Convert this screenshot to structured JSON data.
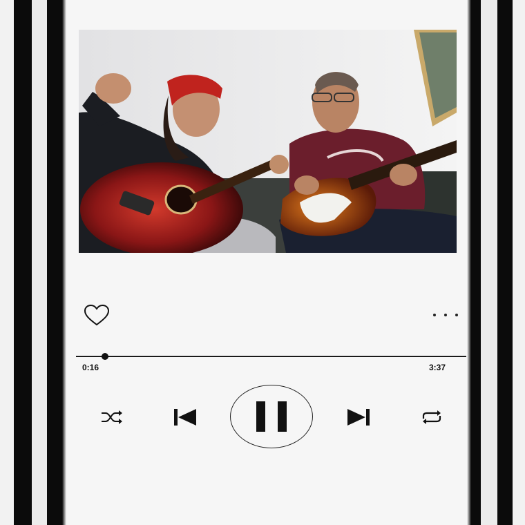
{
  "player": {
    "album_art_description": "",
    "elapsed_time": "0:16",
    "total_time": "3:37",
    "progress": 0.074,
    "like_icon": "heart-icon",
    "more_icon": "more-options-icon",
    "controls": {
      "shuffle_icon": "shuffle-icon",
      "previous_icon": "previous-track-icon",
      "play_pause_icon": "pause-icon",
      "next_icon": "next-track-icon",
      "repeat_icon": "repeat-icon"
    }
  },
  "colors": {
    "background": "#f6f6f6",
    "frame": "#0b0b0b",
    "foreground": "#111111"
  }
}
